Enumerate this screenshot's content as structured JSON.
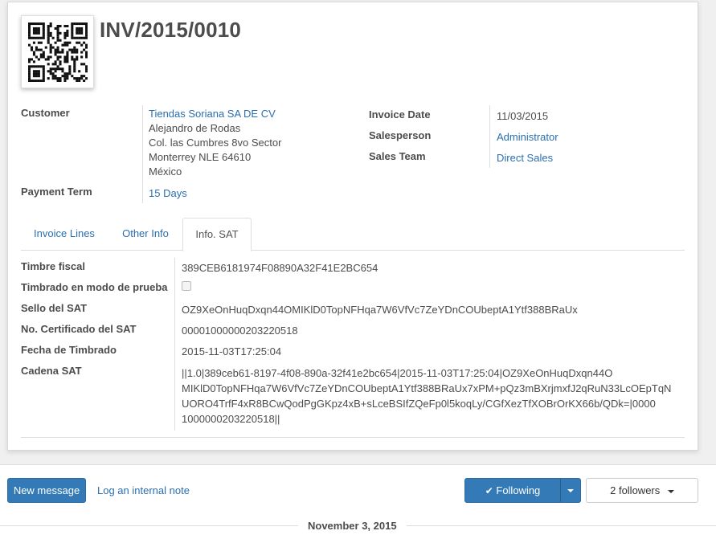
{
  "invoice": {
    "title": "INV/2015/0010"
  },
  "customer": {
    "label": "Customer",
    "name": "Tiendas Soriana SA DE CV",
    "address": [
      "Alejandro de Rodas",
      "Col. las Cumbres 8vo Sector",
      "Monterrey NLE 64610",
      "México"
    ]
  },
  "payment_term": {
    "label": "Payment Term",
    "value": "15 Days"
  },
  "invoice_date": {
    "label": "Invoice Date",
    "value": "11/03/2015"
  },
  "salesperson": {
    "label": "Salesperson",
    "value": "Administrator"
  },
  "sales_team": {
    "label": "Sales Team",
    "value": "Direct Sales"
  },
  "tabs": [
    {
      "label": "Invoice Lines",
      "active": false
    },
    {
      "label": "Other Info",
      "active": false
    },
    {
      "label": "Info. SAT",
      "active": true
    }
  ],
  "sat": {
    "timbre_fiscal": {
      "label": "Timbre fiscal",
      "value": "389CEB6181974F08890A32F41E2BC654"
    },
    "modo_prueba": {
      "label": "Timbrado en modo de prueba",
      "checked": false
    },
    "sello": {
      "label": "Sello del SAT",
      "value": "OZ9XeOnHuqDxqn44OMIKlD0TopNFHqa7W6VfVc7ZeYDnCOUbeptA1Ytf388BRaUx"
    },
    "certificado": {
      "label": "No. Certificado del SAT",
      "value": "00001000000203220518"
    },
    "fecha": {
      "label": "Fecha de Timbrado",
      "value": "2015-11-03T17:25:04"
    },
    "cadena": {
      "label": "Cadena SAT",
      "lines": [
        "||1.0|389ceb61-8197-4f08-890a-32f41e2bc654|2015-11-03T17:25:04|OZ9XeOnHuqDxqn44O",
        "MIKlD0TopNFHqa7W6VfVc7ZeYDnCOUbeptA1Ytf388BRaUx7xPM+pQz3mBXrjmxfJ2qRuN33LcOEpTqN",
        "UORO4TrfF4xR8BCwQodPgGKpz4xB+sLceBSIfZQeFp0l5koqLy/CGfXezTfXOBrOrKX66b/QDk=|0000",
        "1000000203220518||"
      ]
    }
  },
  "chatter": {
    "new_message": "New message",
    "log_note": "Log an internal note",
    "following": "Following",
    "followers": "2 followers",
    "date_separator": "November 3, 2015"
  },
  "colors": {
    "link": "#2a6fb0",
    "primary": "#337ab7"
  },
  "icons": {
    "qr": "qr-code-icon",
    "check": "check-icon",
    "caret": "caret-down-icon"
  }
}
